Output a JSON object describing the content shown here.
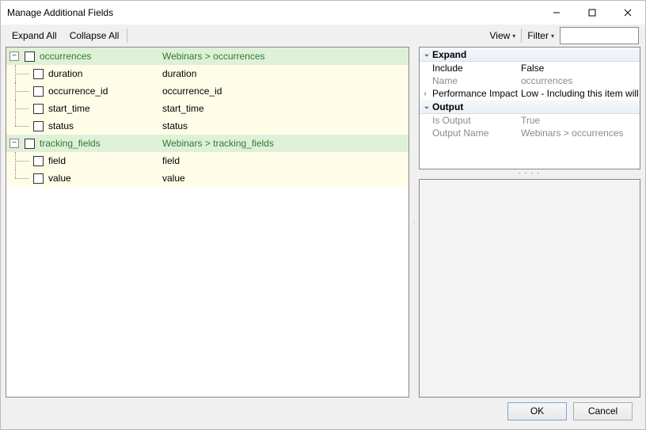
{
  "window": {
    "title": "Manage Additional Fields"
  },
  "toolbar": {
    "expand_all": "Expand All",
    "collapse_all": "Collapse All",
    "view": "View",
    "filter": "Filter",
    "filter_value": ""
  },
  "tree": {
    "groups": [
      {
        "name": "occurrences",
        "path": "Webinars > occurrences",
        "children": [
          {
            "name": "duration",
            "path": "duration"
          },
          {
            "name": "occurrence_id",
            "path": "occurrence_id"
          },
          {
            "name": "start_time",
            "path": "start_time"
          },
          {
            "name": "status",
            "path": "status"
          }
        ]
      },
      {
        "name": "tracking_fields",
        "path": "Webinars > tracking_fields",
        "children": [
          {
            "name": "field",
            "path": "field"
          },
          {
            "name": "value",
            "path": "value"
          }
        ]
      }
    ]
  },
  "props": {
    "sections": {
      "expand": {
        "header": "Expand",
        "include_key": "Include",
        "include_val": "False",
        "name_key": "Name",
        "name_val": "occurrences",
        "perf_key": "Performance Impact",
        "perf_val": "Low - Including this item will have"
      },
      "output": {
        "header": "Output",
        "isout_key": "Is Output",
        "isout_val": "True",
        "outname_key": "Output Name",
        "outname_val": "Webinars > occurrences"
      }
    }
  },
  "footer": {
    "ok": "OK",
    "cancel": "Cancel"
  },
  "icons": {
    "minimize": "minimize-icon",
    "maximize": "maximize-icon",
    "close": "close-icon",
    "caret": "caret-down-icon",
    "expander_minus": "−",
    "expander_chevron_down": "⌄",
    "expander_chevron_right": "›"
  }
}
